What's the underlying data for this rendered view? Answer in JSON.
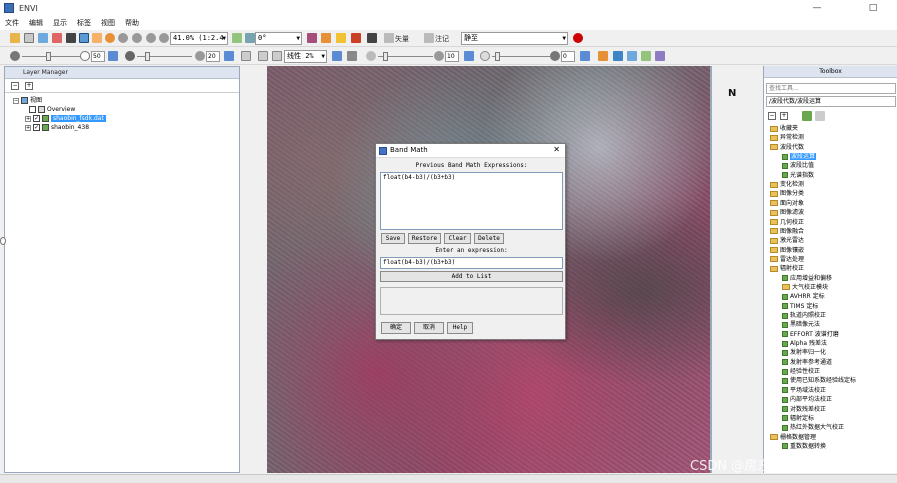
{
  "window": {
    "title": "ENVI",
    "buttons": [
      "—",
      "□"
    ]
  },
  "menu": [
    "文件",
    "编辑",
    "显示",
    "标签",
    "视图",
    "帮助"
  ],
  "toolbar1": {
    "zoom_select": "41.0% (1:2.4",
    "rotation_select": "0°",
    "vector_label": "矢量",
    "annotation_label": "注记",
    "annotation_select": "静至"
  },
  "toolbar2": {
    "brightness_value": "50",
    "contrast_value": "20",
    "stretch_select": "线性 2%",
    "sharpen_value": "10",
    "transparency_value": "0"
  },
  "layer_manager": {
    "title": "Layer Manager",
    "root": "视图",
    "overview": "Overview",
    "layer1": "shaobin_fsdk.dat",
    "layer2": "shaobin_438"
  },
  "band_math": {
    "title": "Band Math",
    "prev_label": "Previous Band Math Expressions:",
    "prev_items": [
      "float(b4-b3)/(b3+b3)"
    ],
    "buttons": {
      "save": "Save",
      "restore": "Restore",
      "clear": "Clear",
      "delete": "Delete"
    },
    "enter_label": "Enter an expression:",
    "expression": "float(b4-b3)/(b3+b3)",
    "add_button": "Add to List",
    "ok": "确定",
    "cancel": "取消",
    "help": "Help",
    "close": "✕"
  },
  "toolbox": {
    "title": "Toolbox",
    "search_placeholder": "查找工具...",
    "path": "/波段代数/波段运算",
    "items": [
      {
        "label": "收藏夹",
        "type": "folder",
        "level": 0
      },
      {
        "label": "异常检测",
        "type": "folder",
        "level": 0
      },
      {
        "label": "波段代数",
        "type": "folder",
        "level": 0
      },
      {
        "label": "波段运算",
        "type": "tool",
        "level": 1,
        "selected": true
      },
      {
        "label": "波段比值",
        "type": "tool",
        "level": 1
      },
      {
        "label": "光谱指数",
        "type": "tool",
        "level": 1
      },
      {
        "label": "变化检测",
        "type": "folder",
        "level": 0
      },
      {
        "label": "图像分类",
        "type": "folder",
        "level": 0
      },
      {
        "label": "面向对象",
        "type": "folder",
        "level": 0
      },
      {
        "label": "图像滤波",
        "type": "folder",
        "level": 0
      },
      {
        "label": "几何校正",
        "type": "folder",
        "level": 0
      },
      {
        "label": "图像融合",
        "type": "folder",
        "level": 0
      },
      {
        "label": "激光雷达",
        "type": "folder",
        "level": 0
      },
      {
        "label": "图像镶嵌",
        "type": "folder",
        "level": 0
      },
      {
        "label": "雷达处理",
        "type": "folder",
        "level": 0
      },
      {
        "label": "辐射校正",
        "type": "folder",
        "level": 0
      },
      {
        "label": "应用增益和偏移",
        "type": "tool",
        "level": 1
      },
      {
        "label": "大气校正模块",
        "type": "folder",
        "level": 1
      },
      {
        "label": "AVHRR 定标",
        "type": "tool",
        "level": 1
      },
      {
        "label": "TIMS 定标",
        "type": "tool",
        "level": 1
      },
      {
        "label": "轨道内照校正",
        "type": "tool",
        "level": 1
      },
      {
        "label": "黑暗像元法",
        "type": "tool",
        "level": 1
      },
      {
        "label": "EFFORT 波谱打磨",
        "type": "tool",
        "level": 1
      },
      {
        "label": "Alpha 残差法",
        "type": "tool",
        "level": 1
      },
      {
        "label": "发射率归一化",
        "type": "tool",
        "level": 1
      },
      {
        "label": "发射率参考通道",
        "type": "tool",
        "level": 1
      },
      {
        "label": "经验性校正",
        "type": "tool",
        "level": 1
      },
      {
        "label": "使用已知系数经验线定标",
        "type": "tool",
        "level": 1
      },
      {
        "label": "平场域法校正",
        "type": "tool",
        "level": 1
      },
      {
        "label": "内部平均法校正",
        "type": "tool",
        "level": 1
      },
      {
        "label": "对数残差校正",
        "type": "tool",
        "level": 1
      },
      {
        "label": "辐射定标",
        "type": "tool",
        "level": 1
      },
      {
        "label": "热红外数据大气校正",
        "type": "tool",
        "level": 1
      },
      {
        "label": "栅格数据管理",
        "type": "folder",
        "level": 0
      },
      {
        "label": "重数数据转换",
        "type": "tool",
        "level": 1
      }
    ]
  },
  "watermark": "CSDN @房东的猫猫"
}
